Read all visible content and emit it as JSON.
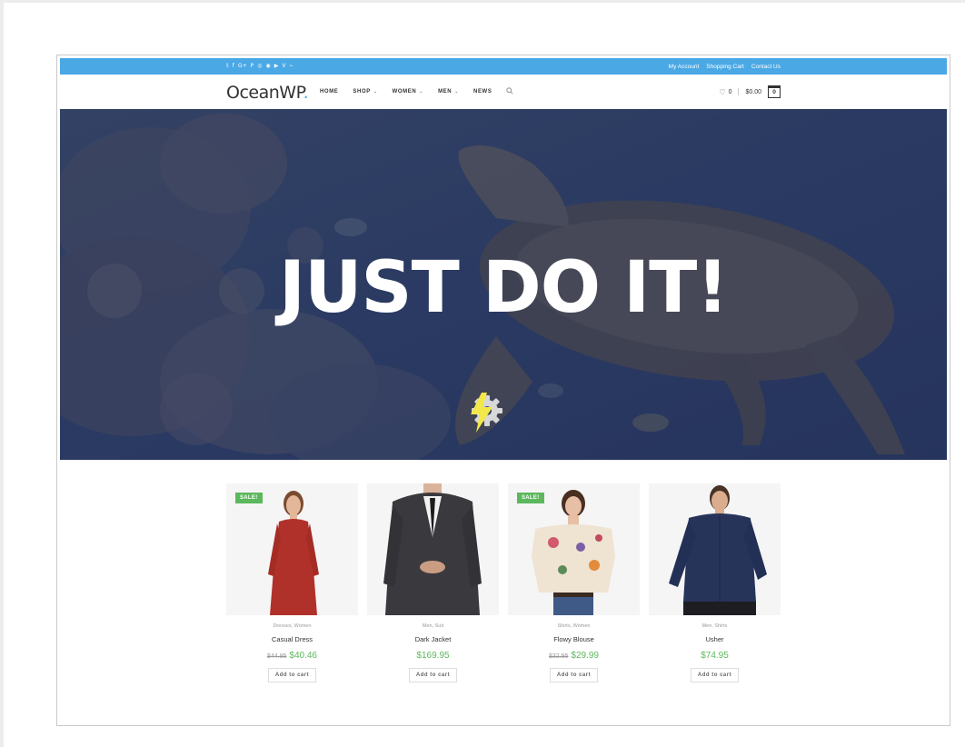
{
  "topbar": {
    "social_icons": [
      "twitter-icon",
      "facebook-icon",
      "google-plus-icon",
      "pinterest-icon",
      "dribbble-icon",
      "instagram-icon",
      "youtube-icon",
      "vimeo-icon",
      "rss-icon"
    ],
    "social_glyphs": [
      "𝕥",
      "f",
      "G+",
      "P",
      "◎",
      "◉",
      "▶",
      "V",
      "⌁"
    ],
    "links": [
      "My Account",
      "Shopping Cart",
      "Contact Us"
    ],
    "color": "#4aa8e5"
  },
  "header": {
    "logo": "OceanWP",
    "logo_dot": ".",
    "nav": [
      {
        "label": "HOME",
        "dropdown": false
      },
      {
        "label": "SHOP",
        "dropdown": true
      },
      {
        "label": "WOMEN",
        "dropdown": true
      },
      {
        "label": "MEN",
        "dropdown": true
      },
      {
        "label": "NEWS",
        "dropdown": false
      }
    ],
    "wishlist_count": "0",
    "cart_total": "$0.00",
    "cart_count": "0"
  },
  "hero": {
    "title": "JUST DO IT!",
    "overlay_color": "#2f3f66"
  },
  "products": [
    {
      "sale": "SALE!",
      "categories": "Dresses, Women",
      "name": "Casual Dress",
      "old_price": "$44.95",
      "price": "$40.46",
      "button": "Add to cart",
      "image": "red-dress-model"
    },
    {
      "sale": "",
      "categories": "Men, Suit",
      "name": "Dark Jacket",
      "old_price": "",
      "price": "$169.95",
      "button": "Add to cart",
      "image": "dark-suit-model"
    },
    {
      "sale": "SALE!",
      "categories": "Shirts, Women",
      "name": "Flowy Blouse",
      "old_price": "$32.95",
      "price": "$29.99",
      "button": "Add to cart",
      "image": "floral-blouse-model"
    },
    {
      "sale": "",
      "categories": "Men, Shirts",
      "name": "Usher",
      "old_price": "",
      "price": "$74.95",
      "button": "Add to cart",
      "image": "navy-shirt-model"
    }
  ],
  "colors": {
    "sale": "#5cb85c",
    "price": "#5cb85c",
    "accent": "#4aa8e5"
  }
}
